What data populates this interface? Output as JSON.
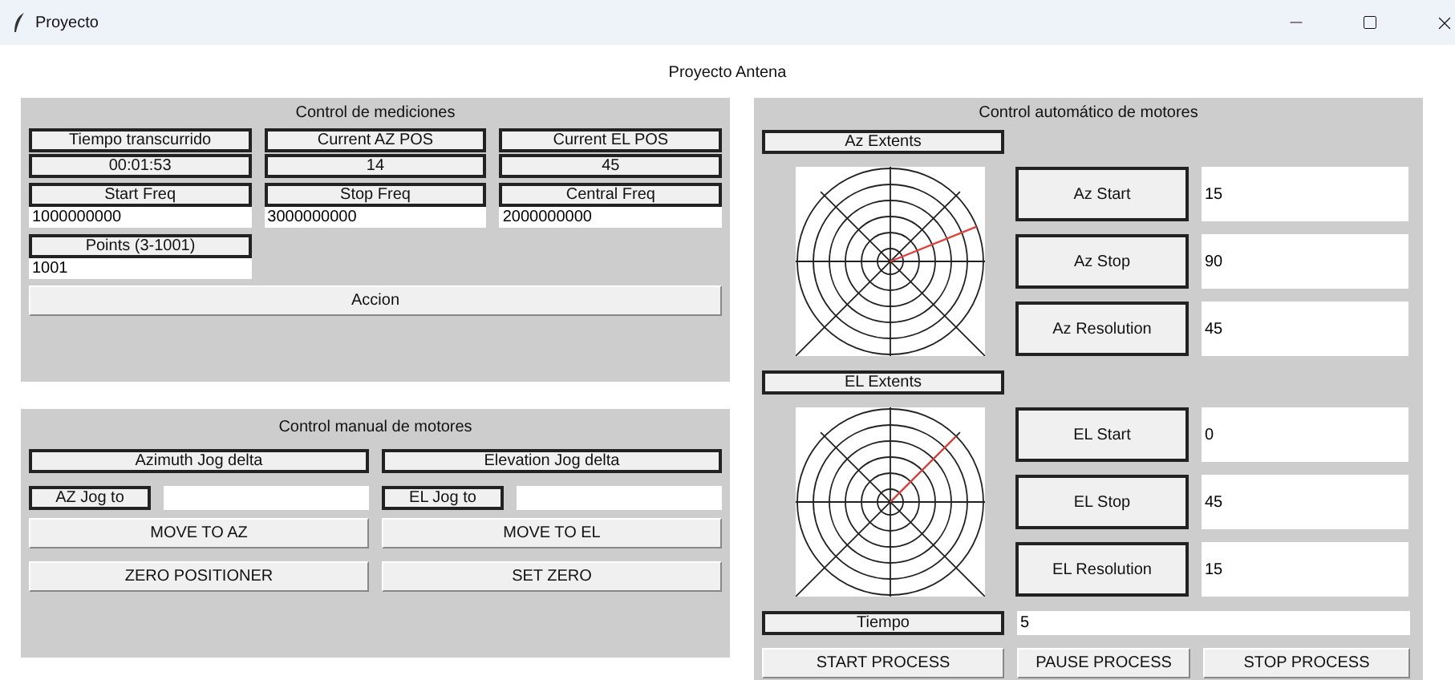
{
  "window": {
    "title": "Proyecto"
  },
  "app_title": "Proyecto Antena",
  "measurements": {
    "title": "Control de mediciones",
    "readouts": [
      {
        "label": "Tiempo transcurrido",
        "value": "00:01:53"
      },
      {
        "label": "Current AZ POS",
        "value": "14"
      },
      {
        "label": "Current EL POS",
        "value": "45"
      }
    ],
    "freq_fields": [
      {
        "label": "Start Freq",
        "value": "1000000000"
      },
      {
        "label": "Stop Freq",
        "value": "3000000000"
      },
      {
        "label": "Central Freq",
        "value": "2000000000"
      }
    ],
    "points": {
      "label": "Points (3-1001)",
      "value": "1001"
    },
    "action_button": "Accion"
  },
  "manual": {
    "title": "Control manual de motores",
    "axes": [
      {
        "delta_label": "Azimuth Jog delta",
        "jog_label": "AZ Jog to",
        "move_button": "MOVE TO AZ",
        "zero_button": "ZERO POSITIONER"
      },
      {
        "delta_label": "Elevation Jog delta",
        "jog_label": "EL Jog to",
        "move_button": "MOVE TO EL",
        "zero_button": "SET ZERO"
      }
    ]
  },
  "auto": {
    "title": "Control automático de motores",
    "sections": [
      {
        "extents_label": "Az Extents",
        "params": [
          {
            "label": "Az Start",
            "value": "15"
          },
          {
            "label": "Az Stop",
            "value": "90"
          },
          {
            "label": "Az Resolution",
            "value": "45"
          }
        ]
      },
      {
        "extents_label": "EL Extents",
        "params": [
          {
            "label": "EL Start",
            "value": "0"
          },
          {
            "label": "EL Stop",
            "value": "45"
          },
          {
            "label": "EL Resolution",
            "value": "15"
          }
        ]
      }
    ],
    "tiempo": {
      "label": "Tiempo",
      "value": "5"
    },
    "process_buttons": [
      "START PROCESS",
      "PAUSE PROCESS",
      "STOP PROCESS"
    ]
  }
}
